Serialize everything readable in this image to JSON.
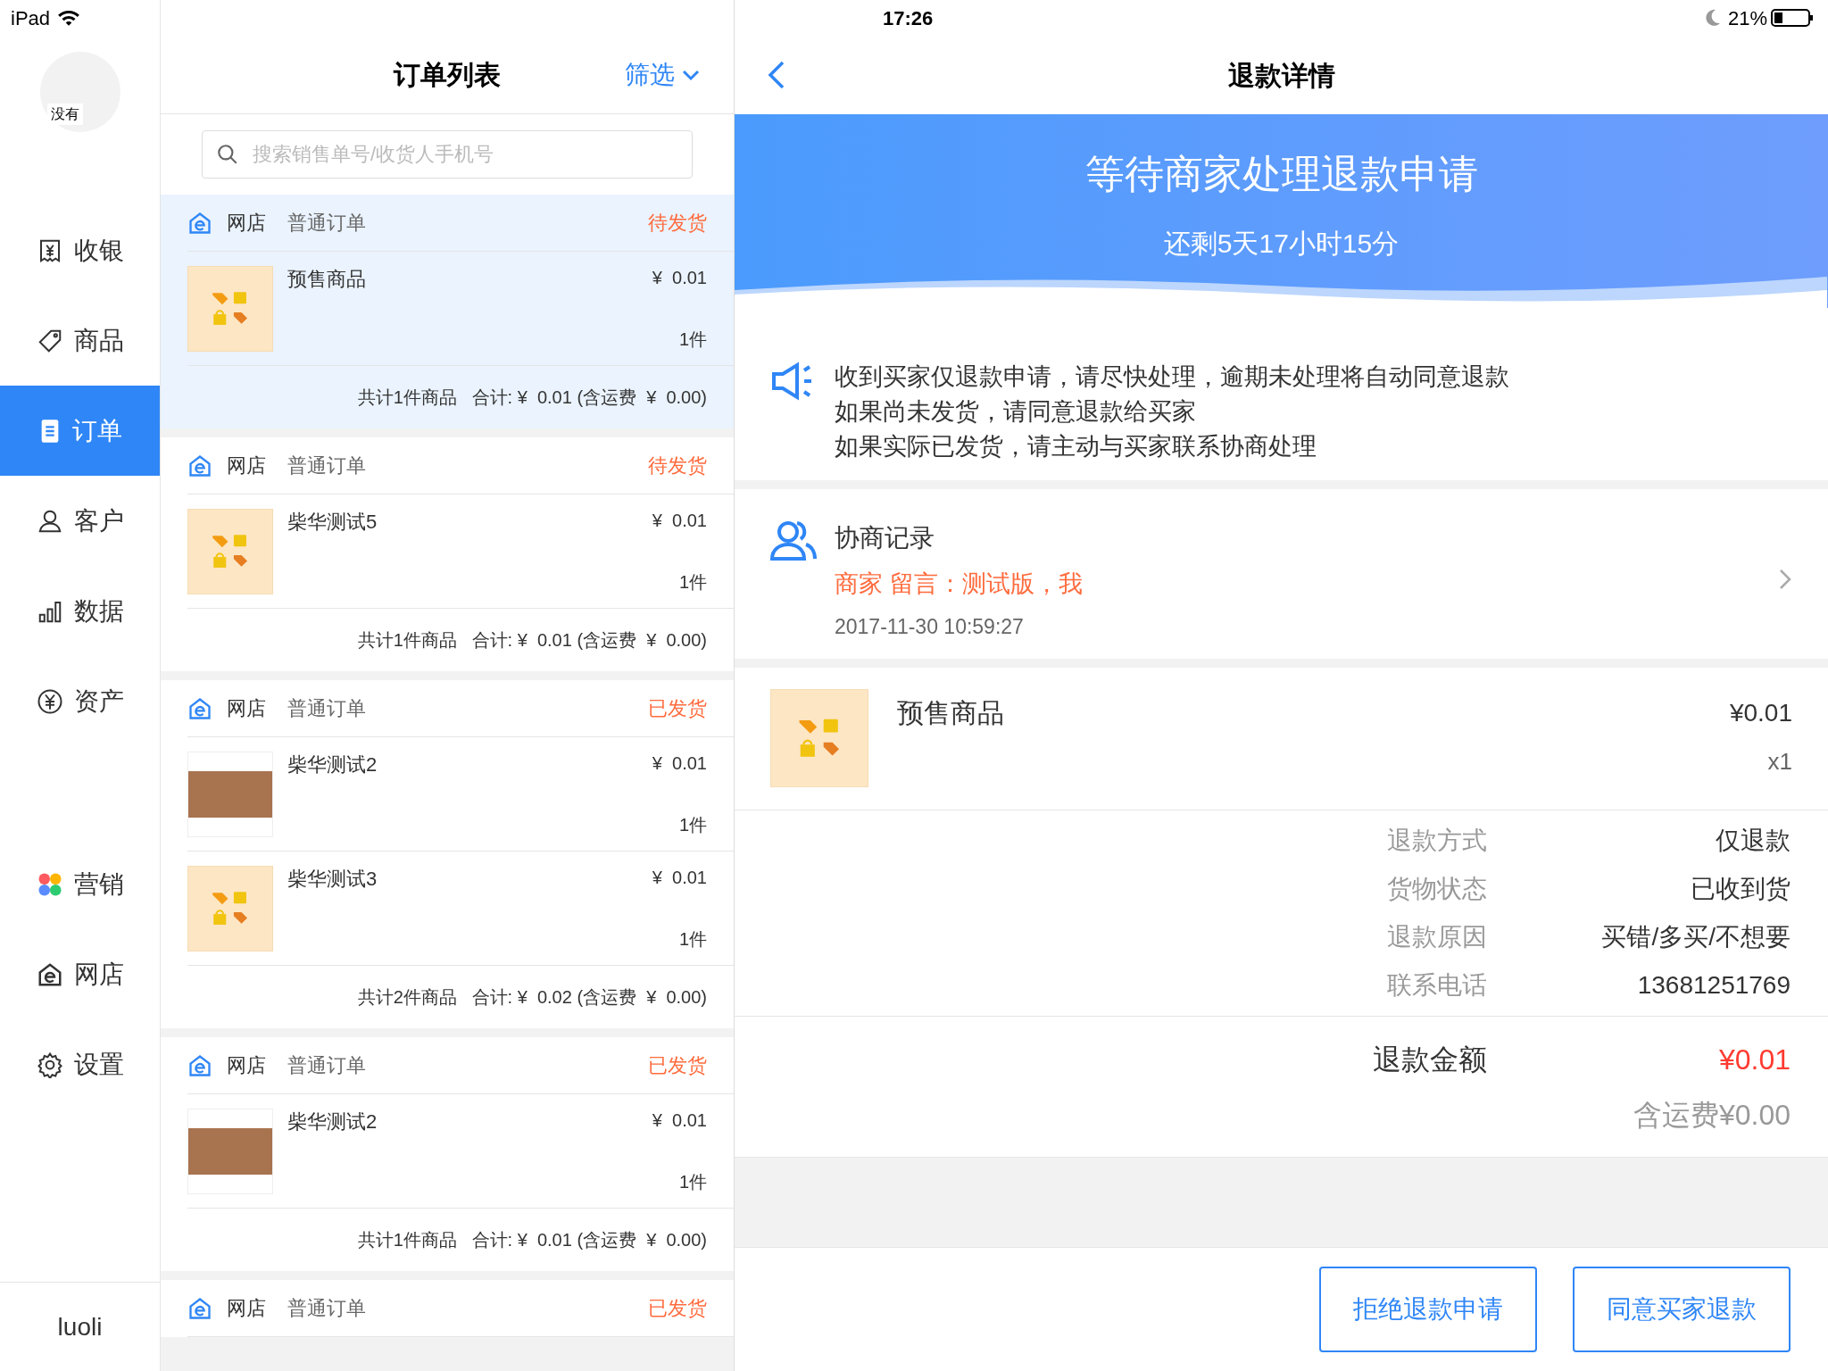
{
  "status_bar": {
    "device": "iPad",
    "time": "17:26",
    "battery": "21%"
  },
  "sidebar": {
    "avatar_text": "没有",
    "items": [
      {
        "label": "收银",
        "selected": false
      },
      {
        "label": "商品",
        "selected": false
      },
      {
        "label": "订单",
        "selected": true
      },
      {
        "label": "客户",
        "selected": false
      },
      {
        "label": "数据",
        "selected": false
      },
      {
        "label": "资产",
        "selected": false
      },
      {
        "label": "营销",
        "selected": false
      },
      {
        "label": "网店",
        "selected": false
      },
      {
        "label": "设置",
        "selected": false
      }
    ],
    "user": "luoli"
  },
  "order_list": {
    "title": "订单列表",
    "filter": "筛选",
    "search": {
      "placeholder": "搜索销售单号/收货人手机号"
    },
    "orders": [
      {
        "shop": "网店",
        "type": "普通订单",
        "status": "待发货",
        "selected": true,
        "items": [
          {
            "name": "预售商品",
            "price": "¥  0.01",
            "qty": "1件",
            "kind": "placeholder"
          }
        ],
        "summary": "共计1件商品   合计: ¥  0.01 (含运费  ¥  0.00)"
      },
      {
        "shop": "网店",
        "type": "普通订单",
        "status": "待发货",
        "selected": false,
        "items": [
          {
            "name": "柴华测试5",
            "price": "¥  0.01",
            "qty": "1件",
            "kind": "placeholder"
          }
        ],
        "summary": "共计1件商品   合计: ¥  0.01 (含运费  ¥  0.00)"
      },
      {
        "shop": "网店",
        "type": "普通订单",
        "status": "已发货",
        "selected": false,
        "items": [
          {
            "name": "柴华测试2",
            "price": "¥  0.01",
            "qty": "1件",
            "kind": "photo"
          },
          {
            "name": "柴华测试3",
            "price": "¥  0.01",
            "qty": "1件",
            "kind": "placeholder"
          }
        ],
        "summary": "共计2件商品   合计: ¥  0.02 (含运费  ¥  0.00)"
      },
      {
        "shop": "网店",
        "type": "普通订单",
        "status": "已发货",
        "selected": false,
        "items": [
          {
            "name": "柴华测试2",
            "price": "¥  0.01",
            "qty": "1件",
            "kind": "photo"
          }
        ],
        "summary": "共计1件商品   合计: ¥  0.01 (含运费  ¥  0.00)"
      },
      {
        "shop": "网店",
        "type": "普通订单",
        "status": "已发货",
        "selected": false
      }
    ]
  },
  "detail": {
    "title": "退款详情",
    "banner": {
      "title": "等待商家处理退款申请",
      "countdown": "还剩5天17小时15分"
    },
    "notice": [
      "收到买家仅退款申请，请尽快处理，逾期未处理将自动同意退款",
      "如果尚未发货，请同意退款给买家",
      "如果实际已发货，请主动与买家联系协商处理"
    ],
    "negotiation": {
      "title": "协商记录",
      "message": "商家 留言：测试版，我",
      "time": "2017-11-30 10:59:27"
    },
    "product": {
      "name": "预售商品",
      "price": "¥0.01",
      "qty": "x1"
    },
    "fields": [
      {
        "label": "退款方式",
        "value": "仅退款"
      },
      {
        "label": "货物状态",
        "value": "已收到货"
      },
      {
        "label": "退款原因",
        "value": "买错/多买/不想要"
      },
      {
        "label": "联系电话",
        "value": "13681251769"
      }
    ],
    "amount": {
      "label": "退款金额",
      "value": "¥0.01",
      "shipping": "含运费¥0.00"
    },
    "buttons": [
      "拒绝退款申请",
      "同意买家退款"
    ]
  }
}
